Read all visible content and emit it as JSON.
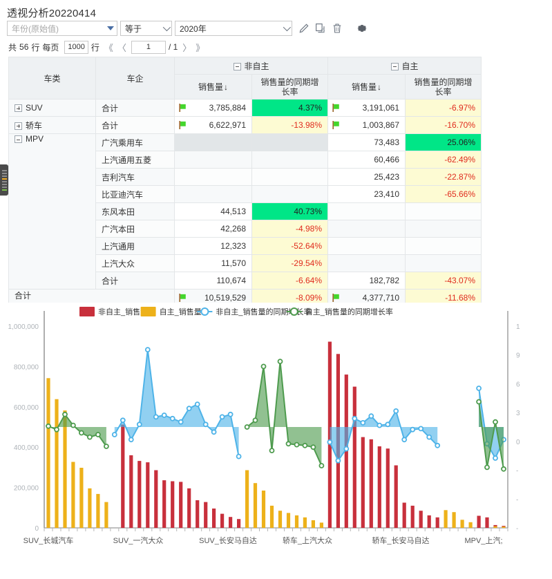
{
  "page": {
    "title": "透视分析20220414"
  },
  "filter": {
    "field_value": "年份(原始值)",
    "operator": "等于",
    "value": "2020年",
    "edit_label": "编辑",
    "copy_label": "复制",
    "delete_label": "删除",
    "settings_label": "设置"
  },
  "pager": {
    "total_prefix": "共",
    "total_count": "56",
    "row_unit": "行",
    "per_page_label": "每页",
    "per_page_value": "1000",
    "per_page_unit": "行",
    "first": "《",
    "prev": "〈",
    "current_page": "1",
    "page_sep": "/ 1",
    "next": "〉",
    "last": "》"
  },
  "table": {
    "col_category": "车类",
    "col_company": "车企",
    "group_nonself": "非自主",
    "group_self": "自主",
    "col_sales": "销售量",
    "col_growth": "销售量的同期增长率",
    "total_label": "合计",
    "rows": [
      {
        "cat": "SUV",
        "cat_state": "collapsed",
        "ent": "合计",
        "ns_sales": "3,785,884",
        "ns_flag": true,
        "ns_growth": "4.37%",
        "ns_growth_style": "green",
        "s_sales": "3,191,061",
        "s_flag": true,
        "s_growth": "-6.97%",
        "s_growth_style": "yellow"
      },
      {
        "cat": "轿车",
        "cat_state": "collapsed",
        "ent": "合计",
        "ns_sales": "6,622,971",
        "ns_flag": true,
        "ns_growth": "-13.98%",
        "ns_growth_style": "yellow",
        "s_sales": "1,003,867",
        "s_flag": true,
        "s_growth": "-16.70%",
        "s_growth_style": "yellow"
      },
      {
        "cat": "MPV",
        "cat_state": "expanded",
        "ent": "广汽乘用车",
        "ns_sales": "",
        "ns_flag": false,
        "ns_growth": "",
        "ns_growth_style": "blank-grey",
        "s_sales": "73,483",
        "s_flag": false,
        "s_growth": "25.06%",
        "s_growth_style": "green"
      },
      {
        "cat": "",
        "cat_state": "none",
        "ent": "上汽通用五菱",
        "ns_sales": "",
        "ns_flag": false,
        "ns_growth": "",
        "ns_growth_style": "blank-light",
        "s_sales": "60,466",
        "s_flag": false,
        "s_growth": "-62.49%",
        "s_growth_style": "yellow"
      },
      {
        "cat": "",
        "cat_state": "none",
        "ent": "吉利汽车",
        "ns_sales": "",
        "ns_flag": false,
        "ns_growth": "",
        "ns_growth_style": "blank-white",
        "s_sales": "25,423",
        "s_flag": false,
        "s_growth": "-22.87%",
        "s_growth_style": "yellow"
      },
      {
        "cat": "",
        "cat_state": "none",
        "ent": "比亚迪汽车",
        "ns_sales": "",
        "ns_flag": false,
        "ns_growth": "",
        "ns_growth_style": "blank-light",
        "s_sales": "23,410",
        "s_flag": false,
        "s_growth": "-65.66%",
        "s_growth_style": "yellow"
      },
      {
        "cat": "",
        "cat_state": "none",
        "ent": "东风本田",
        "ns_sales": "44,513",
        "ns_flag": false,
        "ns_growth": "40.73%",
        "ns_growth_style": "green",
        "s_sales": "",
        "s_flag": false,
        "s_growth": "",
        "s_growth_style": "blank-white"
      },
      {
        "cat": "",
        "cat_state": "none",
        "ent": "广汽本田",
        "ns_sales": "42,268",
        "ns_flag": false,
        "ns_growth": "-4.98%",
        "ns_growth_style": "yellow",
        "s_sales": "",
        "s_flag": false,
        "s_growth": "",
        "s_growth_style": "blank-light"
      },
      {
        "cat": "",
        "cat_state": "none",
        "ent": "上汽通用",
        "ns_sales": "12,323",
        "ns_flag": false,
        "ns_growth": "-52.64%",
        "ns_growth_style": "yellow",
        "s_sales": "",
        "s_flag": false,
        "s_growth": "",
        "s_growth_style": "blank-white"
      },
      {
        "cat": "",
        "cat_state": "none",
        "ent": "上汽大众",
        "ns_sales": "11,570",
        "ns_flag": false,
        "ns_growth": "-29.54%",
        "ns_growth_style": "yellow",
        "s_sales": "",
        "s_flag": false,
        "s_growth": "",
        "s_growth_style": "blank-light"
      },
      {
        "cat": "",
        "cat_state": "none",
        "ent": "合计",
        "ns_sales": "110,674",
        "ns_flag": false,
        "ns_growth": "-6.64%",
        "ns_growth_style": "yellow",
        "s_sales": "182,782",
        "s_flag": false,
        "s_growth": "-43.07%",
        "s_growth_style": "yellow"
      }
    ],
    "grand_total": {
      "cat": "合计",
      "ent": "",
      "ns_sales": "10,519,529",
      "ns_flag": true,
      "ns_growth": "-8.09%",
      "ns_growth_style": "yellow",
      "s_sales": "4,377,710",
      "s_flag": true,
      "s_growth": "-11.68%",
      "s_growth_style": "yellow"
    }
  },
  "chart_data": {
    "type": "bar",
    "title": "",
    "xlabel": "",
    "ylabel": "",
    "y_left_ticks": [
      "1,000,000",
      "800,000",
      "600,000",
      "400,000",
      "200,000",
      "0"
    ],
    "y_left_lim": [
      0,
      1000000
    ],
    "y_right_ticks": [
      "1",
      "9",
      "6",
      "3",
      "0",
      "-",
      "-",
      "-"
    ],
    "y_right_lim": [
      -1.2,
      1.2
    ],
    "x_tick_labels": [
      "SUV_长城汽车",
      "SUV_一汽大众",
      "SUV_长安马自达",
      "轿车_上汽大众",
      "轿车_长安马自达",
      "MPV_上汽;"
    ],
    "grid": false,
    "legend_position": "top",
    "legend": [
      {
        "name": "非自主_销售量",
        "color": "#c8303c",
        "kind": "bar"
      },
      {
        "name": "自主_销售量",
        "color": "#edb11a",
        "kind": "bar"
      },
      {
        "name": "非自主_销售量的同期增长率",
        "color": "#4eb3e8",
        "kind": "line"
      },
      {
        "name": "自主_销售量的同期增长率",
        "color": "#4e9b4e",
        "kind": "line"
      }
    ],
    "series": [
      {
        "name": "非自主_销售量",
        "color": "#c8303c",
        "kind": "bar",
        "values": [
          0,
          0,
          0,
          0,
          0,
          0,
          0,
          0,
          0,
          512000,
          360000,
          332000,
          325000,
          286000,
          236000,
          231000,
          228000,
          196000,
          137000,
          128000,
          96000,
          70000,
          54000,
          44000,
          0,
          0,
          0,
          0,
          0,
          0,
          0,
          0,
          0,
          0,
          923000,
          862000,
          760000,
          700000,
          450000,
          439000,
          404000,
          393000,
          310000,
          125000,
          110000,
          85000,
          62000,
          52000,
          0,
          0,
          0,
          0,
          60000,
          52000,
          14000,
          10000
        ]
      },
      {
        "name": "自主_销售量",
        "color": "#edb11a",
        "kind": "bar",
        "values": [
          742000,
          638000,
          582000,
          327000,
          298000,
          196000,
          168000,
          128000,
          0,
          0,
          0,
          0,
          0,
          0,
          0,
          0,
          0,
          0,
          0,
          0,
          0,
          0,
          0,
          0,
          286000,
          222000,
          185000,
          110000,
          85000,
          74000,
          62000,
          52000,
          38000,
          26000,
          0,
          0,
          0,
          0,
          0,
          0,
          0,
          0,
          0,
          0,
          0,
          0,
          0,
          0,
          88000,
          78000,
          40000,
          28000,
          0,
          0,
          8000,
          6000
        ]
      },
      {
        "name": "非自主_销售量的同期增长率",
        "color": "#4eb3e8",
        "kind": "line",
        "values": [
          null,
          null,
          null,
          null,
          null,
          null,
          null,
          null,
          -0.09,
          0.08,
          -0.15,
          0.03,
          0.92,
          0.12,
          0.14,
          0.1,
          0.06,
          0.22,
          0.27,
          0.03,
          -0.06,
          0.12,
          0.15,
          -0.35,
          null,
          null,
          null,
          null,
          null,
          null,
          null,
          null,
          null,
          null,
          -0.18,
          -0.4,
          -0.26,
          0.1,
          0.05,
          0.13,
          0.02,
          0.03,
          0.19,
          -0.15,
          -0.03,
          -0.02,
          -0.12,
          -0.22,
          null,
          null,
          null,
          null,
          0.46,
          -0.2,
          -0.37,
          -0.15
        ]
      },
      {
        "name": "自主_销售量的同期增长率",
        "color": "#4e9b4e",
        "kind": "line",
        "values": [
          0.01,
          -0.03,
          0.15,
          0.02,
          -0.07,
          -0.12,
          -0.09,
          -0.23,
          null,
          null,
          null,
          null,
          null,
          null,
          null,
          null,
          null,
          null,
          null,
          null,
          null,
          null,
          null,
          null,
          0.0,
          0.08,
          0.72,
          -0.28,
          0.78,
          -0.2,
          -0.21,
          -0.22,
          -0.24,
          -0.46,
          null,
          null,
          null,
          null,
          null,
          null,
          null,
          null,
          null,
          null,
          null,
          null,
          null,
          null,
          null,
          null,
          null,
          null,
          0.3,
          -0.48,
          0.06,
          -0.5
        ]
      }
    ]
  }
}
